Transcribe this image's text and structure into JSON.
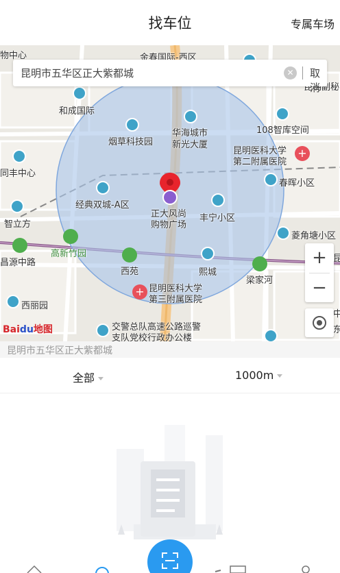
{
  "header": {
    "title": "找车位",
    "right_link": "专属车场"
  },
  "search": {
    "query": "昆明市五华区正大紫都城",
    "cancel_label": "取消"
  },
  "map": {
    "provider_logo": "Bai",
    "provider_logo_paw": "du",
    "provider_logo_suffix": "地图",
    "labels": {
      "l1": "物中心",
      "l2": "金春国际-西区",
      "l3": "昆明副秘",
      "l4": "和成国际",
      "l5": "108智库空间",
      "l6": "烟草科技园",
      "l7": "华海城市",
      "l8": "新光大厦",
      "l9": "昆明医科大学",
      "l10": "第二附属医院",
      "l11": "同丰中心",
      "l12": "春晖小区",
      "l13": "经典双城-A区",
      "l14": "正大风尚",
      "l15": "购物广场",
      "l16": "丰宁小区",
      "l17": "智立方",
      "l18": "菱角塘小区",
      "l19": "高新竹园",
      "l20": "昌源中路",
      "l21": "西苑",
      "l22": "熙城",
      "l23": "梁家河",
      "l24": "昆明医科大学",
      "l25": "第三附属医院",
      "l26": "西丽园",
      "l27": "交警总队高速公路巡警",
      "l28": "支队党校行政办公楼",
      "l29": "昆",
      "l30": "中",
      "l31": "东"
    },
    "zoom_in": "+",
    "zoom_out": "−"
  },
  "address": "昆明市五华区正大紫都城",
  "filters": {
    "type": "全部",
    "radius": "1000m"
  },
  "colors": {
    "accent": "#2a9af0",
    "circle": "#a9c4ea",
    "hospital": "#e8505b",
    "poi": "#3fa3c8"
  }
}
